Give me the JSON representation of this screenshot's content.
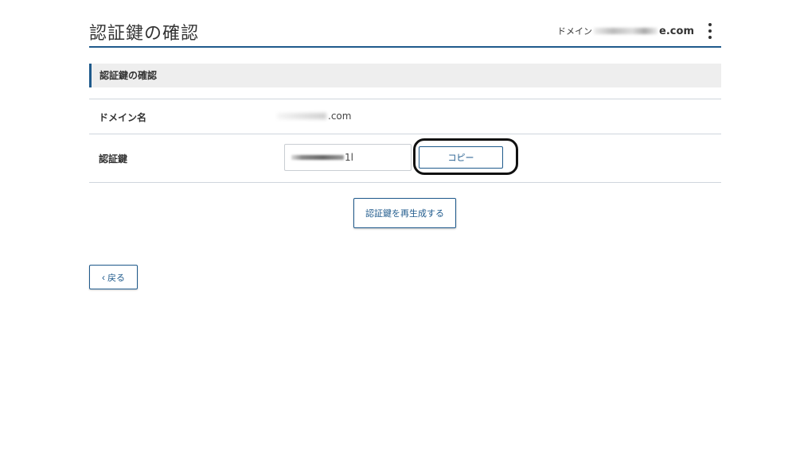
{
  "header": {
    "page_title": "認証鍵の確認",
    "domain_prefix": "ドメイン",
    "domain_suffix": "e.com",
    "menu_icon": "kebab-menu-icon"
  },
  "section": {
    "title": "認証鍵の確認"
  },
  "domain_row": {
    "label": "ドメイン名",
    "value_suffix": ".com"
  },
  "key_row": {
    "label": "認証鍵",
    "value_suffix": "1l",
    "copy_label": "コピー"
  },
  "actions": {
    "regenerate_label": "認証鍵を再生成する",
    "back_label": "戻る",
    "back_icon": "chevron-left-icon"
  },
  "colors": {
    "accent": "#1f5a8c",
    "section_bg": "#eeeeee",
    "divider": "#cfd6dd"
  }
}
